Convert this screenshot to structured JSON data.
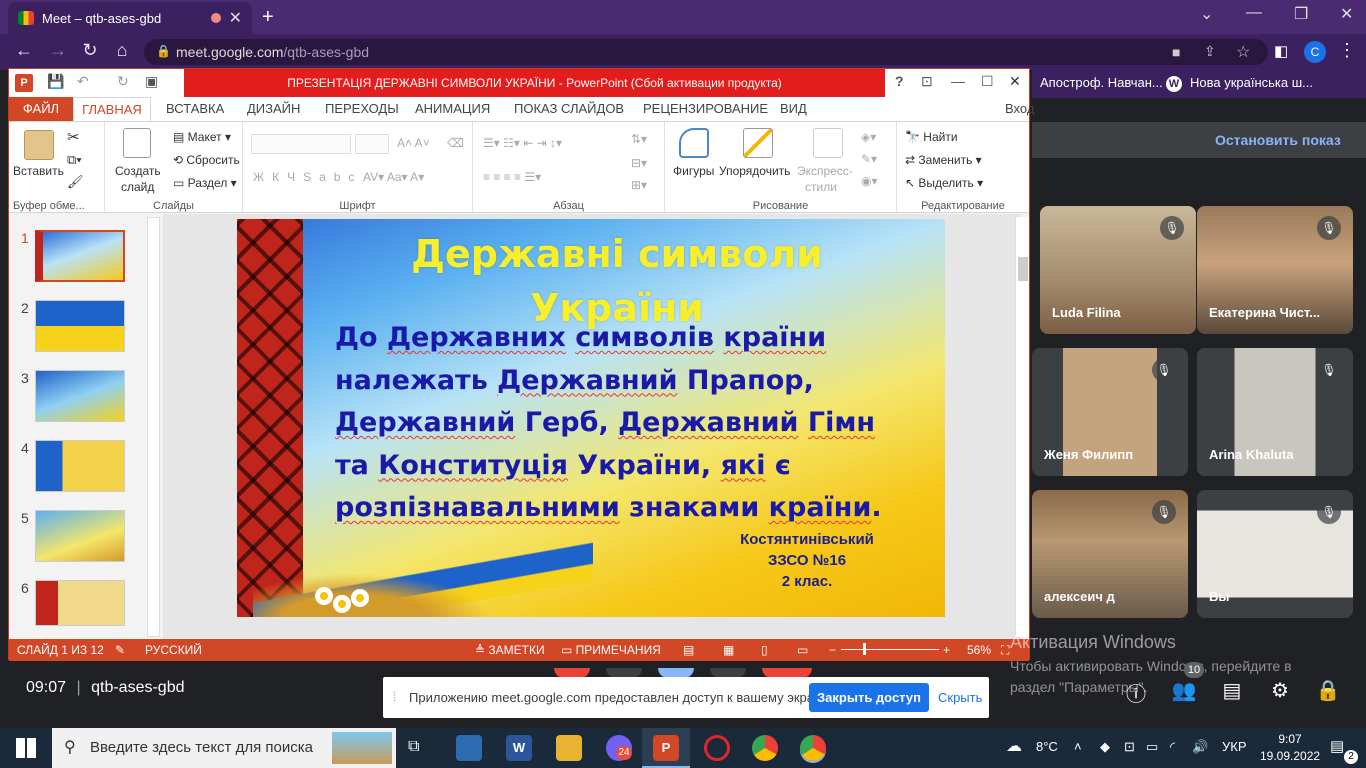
{
  "browser": {
    "tab_title": "Meet – qtb-ases-gbd",
    "url_host": "meet.google.com",
    "url_path": "/qtb-ases-gbd",
    "profile_initial": "C"
  },
  "bookmarks": [
    {
      "label": "Апостроф. Навчан..."
    },
    {
      "label": "Нова українська ш..."
    }
  ],
  "powerpoint": {
    "title": "ПРЕЗЕНТАЦІЯ  ДЕРЖАВНІ СИМВОЛИ УКРАЇНИ -  PowerPoint (Сбой активации продукта)",
    "signin": "Вход",
    "tabs": [
      "ФАЙЛ",
      "ГЛАВНАЯ",
      "ВСТАВКА",
      "ДИЗАЙН",
      "ПЕРЕХОДЫ",
      "АНИМАЦИЯ",
      "ПОКАЗ СЛАЙДОВ",
      "РЕЦЕНЗИРОВАНИЕ",
      "ВИД"
    ],
    "ribbon": {
      "clipboard": {
        "paste": "Вставить",
        "label": "Буфер обме..."
      },
      "slides": {
        "new_slide_1": "Создать",
        "new_slide_2": "слайд",
        "layout": "Макет",
        "reset": "Сбросить",
        "section": "Раздел",
        "label": "Слайды"
      },
      "font": {
        "label": "Шрифт"
      },
      "paragraph": {
        "label": "Абзац"
      },
      "drawing": {
        "shapes": "Фигуры",
        "arrange": "Упорядочить",
        "quick_styles_1": "Экспресс-",
        "quick_styles_2": "стили",
        "label": "Рисование"
      },
      "editing": {
        "find": "Найти",
        "replace": "Заменить",
        "select": "Выделить",
        "label": "Редактирование"
      }
    },
    "thumb_numbers": [
      "1",
      "2",
      "3",
      "4",
      "5",
      "6"
    ],
    "slide": {
      "title_line1": "Державні символи",
      "title_line2": "України",
      "body": [
        [
          "До ",
          "Державних",
          " ",
          "символів",
          " ",
          "країни",
          ""
        ],
        [
          "належать ",
          "Державний",
          " Прапор,",
          "",
          "",
          "",
          ""
        ],
        [
          "",
          "Державний",
          " Герб, ",
          "Державний",
          " ",
          "Гімн",
          ""
        ],
        [
          "та  ",
          "Конституція",
          " України, ",
          "які",
          " є",
          "",
          ""
        ],
        [
          "",
          "розпізнавальними",
          " знаками ",
          "країни",
          ".",
          "",
          ""
        ]
      ],
      "school_line1": "Костянтинівський",
      "school_line2": "ЗЗСО №16",
      "school_line3": "2 клас."
    },
    "status": {
      "slide_count": "СЛАЙД 1 ИЗ 12",
      "language": "РУССКИЙ",
      "notes": "ЗАМЕТКИ",
      "comments": "ПРИМЕЧАНИЯ",
      "zoom": "56%"
    }
  },
  "meet": {
    "stop_presenting": "Остановить показ",
    "participants": [
      {
        "name": "Luda Filina"
      },
      {
        "name": "Екатерина Чист..."
      },
      {
        "name": "Женя Филипп"
      },
      {
        "name": "Arina Khaluta"
      },
      {
        "name": "алексеич д"
      },
      {
        "name": "Вы"
      }
    ],
    "time": "09:07",
    "meeting_code": "qtb-ases-gbd",
    "share_notice": "Приложению meet.google.com предоставлен доступ к вашему экрану.",
    "stop_sharing": "Закрыть доступ",
    "hide": "Скрыть",
    "people_count": "10"
  },
  "windows_activation": {
    "title": "Активация Windows",
    "line1": "Чтобы активировать Windows, перейдите в",
    "line2": "раздел \"Параметры\"."
  },
  "taskbar": {
    "search_placeholder": "Введите здесь текст для поиска",
    "viber_badge": "24",
    "weather": "8°C",
    "language": "УКР",
    "clock_time": "9:07",
    "clock_date": "19.09.2022",
    "notifications": "2"
  },
  "colors": {
    "ppt_accent": "#d24726",
    "meet_blue": "#1a73e8",
    "slide_title": "#f7ef2a",
    "slide_body": "#1b1aa8"
  }
}
